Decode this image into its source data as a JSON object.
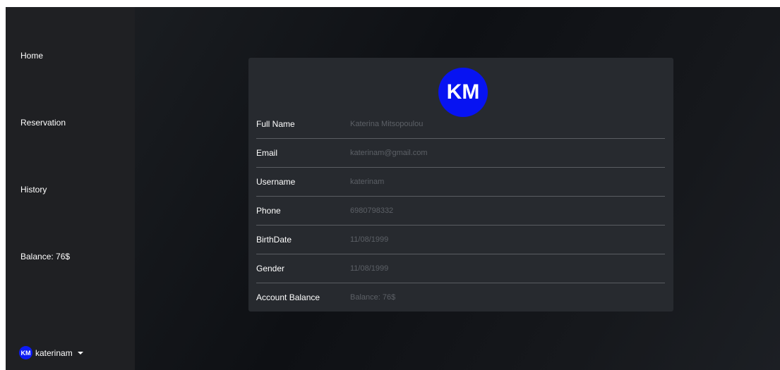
{
  "sidebar": {
    "items": [
      {
        "label": "Home"
      },
      {
        "label": "Reservation"
      },
      {
        "label": "History"
      },
      {
        "label": "Balance: 76$"
      }
    ],
    "user": {
      "initials": "KM",
      "username": "katerinam"
    }
  },
  "profile": {
    "avatar_initials": "KM",
    "rows": [
      {
        "label": "Full Name",
        "value": "Katerina Mitsopoulou"
      },
      {
        "label": "Email",
        "value": "katerinam@gmail.com"
      },
      {
        "label": "Username",
        "value": "katerinam"
      },
      {
        "label": "Phone",
        "value": "6980798332"
      },
      {
        "label": "BirthDate",
        "value": "11/08/1999"
      },
      {
        "label": "Gender",
        "value": "11/08/1999"
      },
      {
        "label": "Account Balance",
        "value": "Balance: 76$"
      }
    ]
  },
  "colors": {
    "avatar": "#0713f2",
    "sidebar": "#1f2023",
    "card": "#272a2f"
  },
  "icons": {
    "user_menu": "caret-down-icon"
  }
}
